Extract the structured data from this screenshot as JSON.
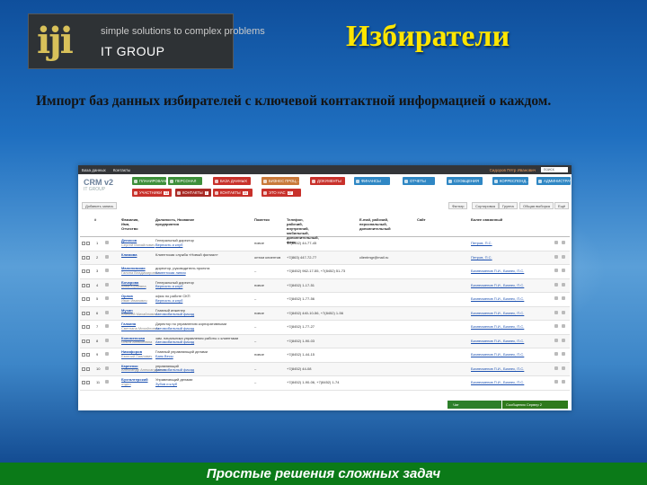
{
  "slide": {
    "logo_mark": "iji",
    "logo_tagline": "simple solutions to complex problems",
    "logo_company": "IT GROUP",
    "title": "Избиратели",
    "description": "Импорт баз данных избирателей с ключевой контактной информацией о каждом.",
    "footer": "Простые решения сложных задач"
  },
  "app": {
    "topbar": {
      "items": [
        "База данных",
        "Контакты"
      ],
      "user": "Сидоров Пётр Иванович",
      "search_placeholder": "поиск"
    },
    "logo": "CRM v2",
    "logo_sub": "IT GROUP",
    "nav_row1": [
      {
        "label": "ПЛАНИРОВАНИЕ",
        "color": "#3d8f3a"
      },
      {
        "label": "ПЕРСОНАЛ",
        "color": "#3d8f3a"
      },
      {
        "label": "БАЗА ДАННЫХ",
        "color": "#c8312b"
      },
      {
        "label": "БИЗНЕС ПРОЦ...",
        "color": "#c9793a"
      },
      {
        "label": "ДОКУМЕНТЫ",
        "color": "#c8312b"
      },
      {
        "label": "ФИНАНСЫ",
        "color": "#2f87c4"
      },
      {
        "label": "ОТЧЕТЫ",
        "color": "#2f87c4"
      },
      {
        "label": "СООБЩЕНИЯ",
        "color": "#2f87c4"
      },
      {
        "label": "КОРРЕСПОНД...",
        "color": "#2f87c4"
      },
      {
        "label": "АДМИНИСТРАТОР",
        "color": "#2f87c4"
      }
    ],
    "nav_row2": [
      {
        "label": "УЧАСТНИКИ",
        "count": "13",
        "color": "#c8312b"
      },
      {
        "label": "КОНТАКТЫ",
        "count": "7",
        "color": "#c8312b"
      },
      {
        "label": "КОНТАКТЫ",
        "count": "34",
        "color": "#c8312b"
      },
      {
        "label": "ЭТО НАС",
        "count": "27",
        "color": "#c8312b"
      }
    ],
    "toolbar": {
      "add_label": "Добавить запись",
      "right": [
        "Фильтр",
        "Сортировка",
        "Группа",
        "Общая выборка",
        "Ещё"
      ]
    },
    "columns": [
      "#",
      "Фамилия, Имя, Отчество",
      "Должность, Название предприятия",
      "Пометки",
      "Телефон, рабочий, внутренний, мобильный, дополнительный, факс",
      "E-mail, рабочий, персональный, дополнительный",
      "Сайт",
      "Более связанный"
    ],
    "rows": [
      {
        "n": "1",
        "name": "Денисов",
        "sub": "Сергей Михайлович",
        "pos": "Генеральный директор",
        "org": "Верность и клуб",
        "note": "новое",
        "phone": "+7(8452) 44-77-45",
        "email": "",
        "rel": "Петров, П.С."
      },
      {
        "n": "2",
        "name": "Климова",
        "sub": "",
        "pos": "Клиентская служба «Новый филиал»",
        "org": "",
        "note": "оптом клиентов",
        "phone": "+7(863) 447-72-77",
        "email": "clientmgr@mail.ru",
        "rel": "Петров, П.С."
      },
      {
        "n": "3",
        "name": "Малиновская",
        "sub": "Галина Владимировна",
        "pos": "директор, руководитель проекта",
        "org": "Клиентская линия",
        "note": "–",
        "phone": "+7(8452) 962-17-55, +7(8452) 51-73",
        "email": "",
        "rel": "Бизнесменов П.И., Бизнес, П.С."
      },
      {
        "n": "4",
        "name": "Бочарова",
        "sub": "Анна Юрьевна",
        "pos": "Генеральный директор",
        "org": "Верность и клуб",
        "note": "новое",
        "phone": "+7(8452) 1-17-51",
        "email": "",
        "rel": "Бизнесменов П.И., Бизнес, П.С."
      },
      {
        "n": "5",
        "name": "Орлов",
        "sub": "Иван Иванович",
        "pos": "офис по работе СКП",
        "org": "Верность и клуб",
        "note": "–",
        "phone": "+7(8452) 1-77-56",
        "email": "",
        "rel": "Бизнесменов П.И., Бизнес, П.С."
      },
      {
        "n": "6",
        "name": "Мухин",
        "sub": "Алексей Михайлович",
        "pos": "Главный инженер",
        "org": "Автомобильный фасад",
        "note": "новое",
        "phone": "+7(8452) 440-10-56, +7(8452) 1-56",
        "email": "",
        "rel": "Бизнесменов П.И., Бизнес, П.С."
      },
      {
        "n": "7",
        "name": "Галкина",
        "sub": "Светлана Михайловна",
        "pos": "Директор по управлению корпоративными",
        "org": "Автомобильный фасад",
        "note": "–",
        "phone": "+7(8452) 1-77-27",
        "email": "",
        "rel": "Бизнесменов П.И., Бизнес, П.С."
      },
      {
        "n": "8",
        "name": "Коломенская",
        "sub": "Ольга Алексеевна",
        "pos": "зам. начальника управления работы с клиентами",
        "org": "Автомобильный фасад",
        "note": "–",
        "phone": "+7(8452) 1-90-03",
        "email": "",
        "rel": "Бизнесменов П.И., Бизнес, П.С."
      },
      {
        "n": "9",
        "name": "Никифоров",
        "sub": "Евгений Павлович",
        "pos": "Главный управляющий делами",
        "org": "Банк Весы",
        "note": "новое",
        "phone": "+7(8452) 1-44-15",
        "email": "",
        "rel": "Бизнесменов П.И., Бизнес, П.С."
      },
      {
        "n": "10",
        "name": "Карпенко",
        "sub": "Александр Александрович",
        "pos": "управляющий",
        "org": "Автомобильный фасад",
        "note": "–",
        "phone": "+7(8452) 44-08",
        "email": "",
        "rel": "Бизнесменов П.И., Бизнес, П.С."
      },
      {
        "n": "11",
        "name": "Бухгалтерский",
        "sub": "отдел",
        "pos": "Управляющий делами",
        "org": "Зубов и клуб",
        "note": "–",
        "phone": "+7(8452) 1-90-06, +7(8452) 1-74",
        "email": "",
        "rel": "Бизнесменов П.И., Бизнес, П.С."
      }
    ],
    "status": {
      "chat": "Чат",
      "right": "Сообщения Сервер 2"
    }
  }
}
